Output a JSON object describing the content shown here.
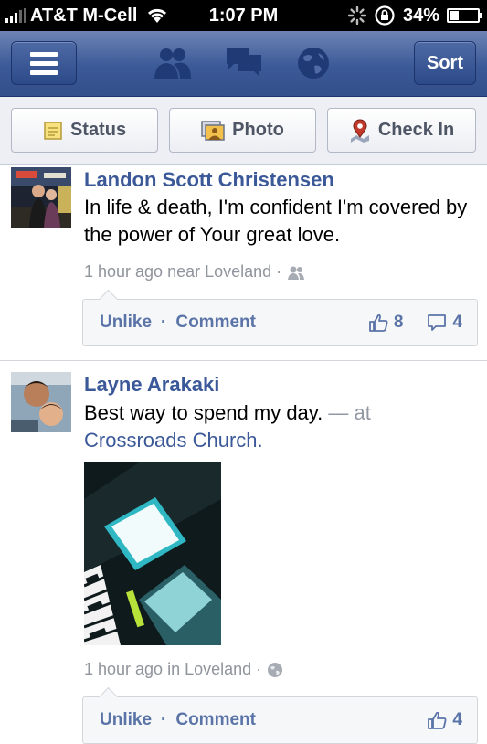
{
  "status_bar": {
    "carrier": "AT&T M-Cell",
    "time": "1:07 PM",
    "battery": "34%",
    "battery_level": 0.34
  },
  "nav": {
    "sort_label": "Sort"
  },
  "publisher": {
    "status_label": "Status",
    "photo_label": "Photo",
    "checkin_label": "Check In"
  },
  "stories": [
    {
      "author": "Landon Scott Christensen",
      "message": "In life & death, I'm confident I'm covered by the power of Your great love.",
      "meta": "1 hour ago near Loveland ·",
      "audience_icon": "friends-icon",
      "unlike_label": "Unlike",
      "separator": "·",
      "comment_label": "Comment",
      "likes": "8",
      "comments": "4"
    },
    {
      "author": "Layne Arakaki",
      "message": "Best way to spend my day.",
      "at_text": "— at",
      "place": "Crossroads Church.",
      "meta": "1 hour ago in Loveland ·",
      "audience_icon": "globe-icon",
      "unlike_label": "Unlike",
      "separator": "·",
      "comment_label": "Comment",
      "likes": "4"
    }
  ],
  "colors": {
    "brand": "#3b5998",
    "link": "#3b5998",
    "meta": "#90949c"
  }
}
